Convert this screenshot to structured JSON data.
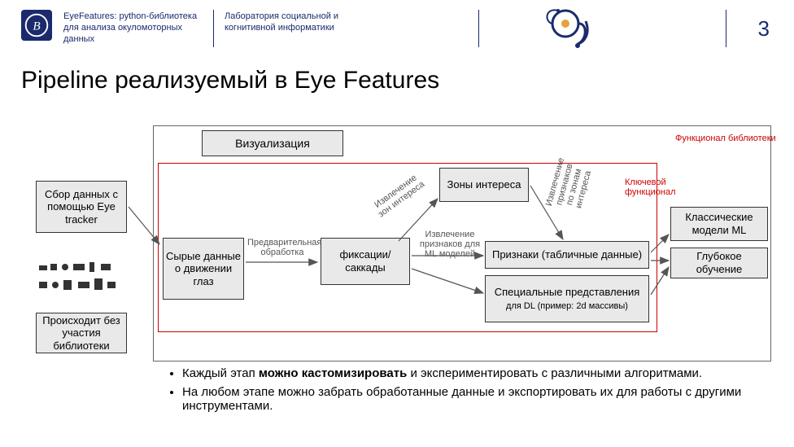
{
  "header": {
    "left_text": "EyeFeatures: python-библиотека для анализа окуломоторных данных",
    "right_text": "Лаборатория социальной и когнитивной информатики",
    "page_number": "3"
  },
  "title": "Pipeline реализуемый в Eye Features",
  "legend": {
    "library_func": "Функционал библиотеки",
    "key_func": "Ключевой функционал"
  },
  "diagram": {
    "viz": "Визуализация",
    "collect": "Сбор данных с помощью Eye tracker",
    "outside_lib": "Происходит без участия библиотеки",
    "raw": "Сырые данные о движении глаз",
    "fixations": "фиксации/ саккады",
    "aoi": "Зоны интереса",
    "features_tab": "Признаки (табличные данные)",
    "special_repr_html": "Специальные представления <span style='font-size:11px'>для DL (пример: 2d массивы)</span>",
    "classic_ml": "Классические модели ML",
    "deep_learning": "Глубокое обучение",
    "edge_preproc": "Предварительная обработка",
    "edge_extract_aoi": "Извлечение зон интереса",
    "edge_feat_ml": "Извлечение признаков для ML моделей",
    "edge_feat_aoi": "Извлечение признаков по зонам интереса"
  },
  "bullets": {
    "b1_html": "Каждый этап <b>можно кастомизировать</b> и экспериментировать с различными алгоритмами.",
    "b2": "На любом этапе можно забрать обработанные данные и экспортировать их для работы с другими инструментами."
  }
}
